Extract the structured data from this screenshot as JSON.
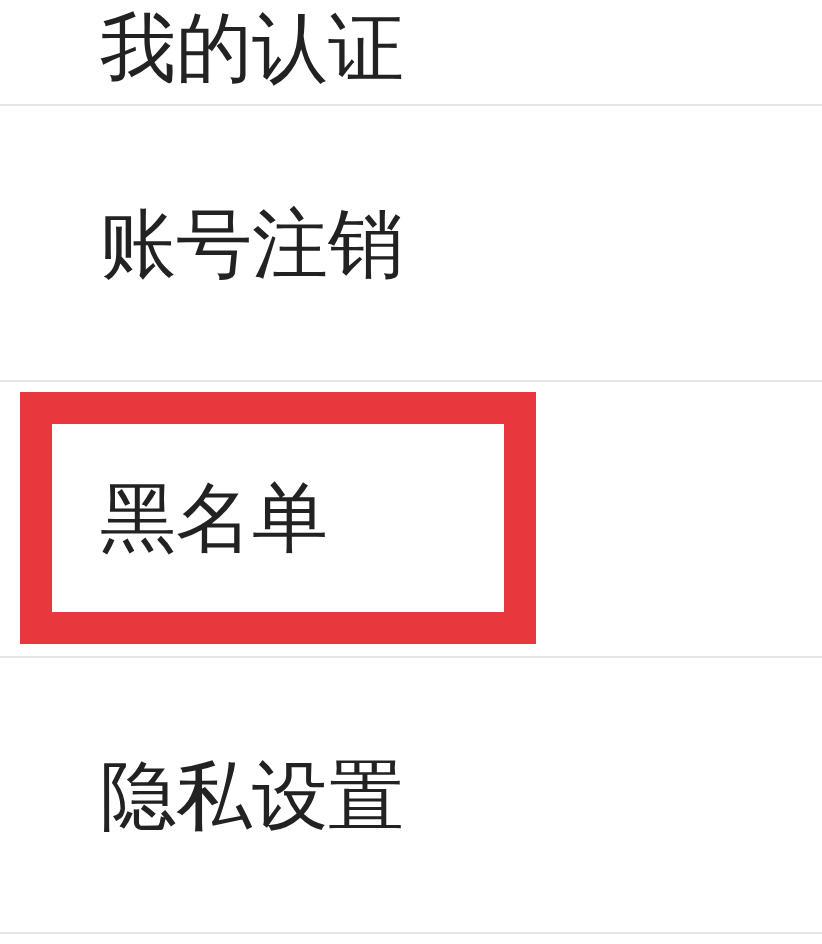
{
  "menu_items": [
    {
      "label": "我的认证",
      "highlighted": false
    },
    {
      "label": "账号注销",
      "highlighted": false
    },
    {
      "label": "黑名单",
      "highlighted": true
    },
    {
      "label": "隐私设置",
      "highlighted": false
    }
  ]
}
